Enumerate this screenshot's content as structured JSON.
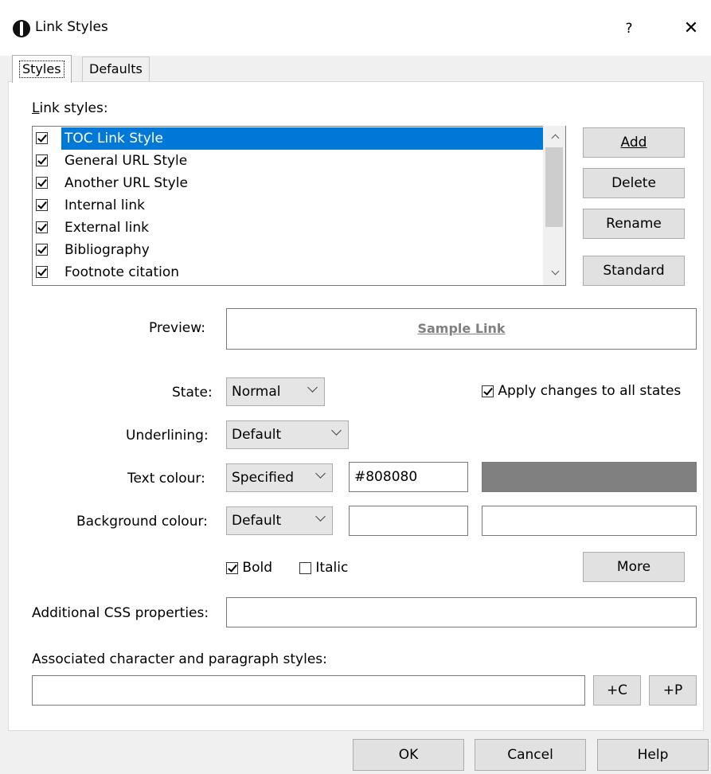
{
  "window": {
    "title": "Link Styles",
    "help_glyph": "?",
    "close_glyph": "✕"
  },
  "tabs": [
    {
      "label": "Styles",
      "active": true
    },
    {
      "label": "Defaults",
      "active": false
    }
  ],
  "link_styles": {
    "label": "Link styles:",
    "items": [
      {
        "label": "TOC Link Style",
        "checked": true,
        "selected": true
      },
      {
        "label": "General URL Style",
        "checked": true,
        "selected": false
      },
      {
        "label": "Another URL Style",
        "checked": true,
        "selected": false
      },
      {
        "label": "Internal link",
        "checked": true,
        "selected": false
      },
      {
        "label": "External link",
        "checked": true,
        "selected": false
      },
      {
        "label": "Bibliography",
        "checked": true,
        "selected": false
      },
      {
        "label": "Footnote citation",
        "checked": true,
        "selected": false
      }
    ],
    "buttons": {
      "add": "Add",
      "delete": "Delete",
      "rename": "Rename",
      "standard": "Standard"
    }
  },
  "preview": {
    "label": "Preview:",
    "sample_text": "Sample Link",
    "sample_color": "#808080"
  },
  "state": {
    "label": "State:",
    "value": "Normal"
  },
  "apply_all": {
    "label": "Apply changes to all states",
    "checked": true
  },
  "underlining": {
    "label": "Underlining:",
    "value": "Default"
  },
  "text_colour": {
    "label": "Text colour:",
    "mode": "Specified",
    "hex": "#808080",
    "swatch": "#808080"
  },
  "background_colour": {
    "label": "Background colour:",
    "mode": "Default",
    "hex": "",
    "swatch": ""
  },
  "bold": {
    "label": "Bold",
    "checked": true
  },
  "italic": {
    "label": "Italic",
    "checked": false
  },
  "more_button": "More",
  "additional_css": {
    "label": "Additional CSS properties:",
    "value": ""
  },
  "associated": {
    "label": "Associated character and paragraph styles:",
    "value": "",
    "add_char": "+C",
    "add_para": "+P"
  },
  "footer": {
    "ok": "OK",
    "cancel": "Cancel",
    "help": "Help"
  }
}
